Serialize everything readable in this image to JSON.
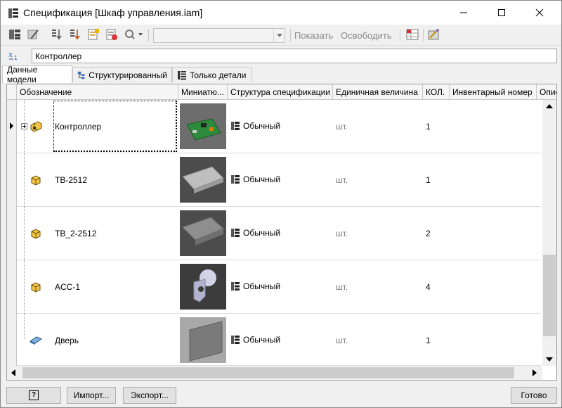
{
  "window": {
    "title": "Спецификация [Шкаф управления.iam]"
  },
  "toolbar": {
    "combo_value": "",
    "show_label": "Показать",
    "release_label": "Освободить"
  },
  "formula": {
    "value": "Контроллер"
  },
  "tabs": [
    {
      "label": "Данные модели",
      "active": true
    },
    {
      "label": "Структурированный",
      "active": false
    },
    {
      "label": "Только детали",
      "active": false
    }
  ],
  "columns": [
    "Обозначение",
    "Миниатю...",
    "Структура спецификации",
    "Единичная величина",
    "КОЛ.",
    "Инвентарный номер",
    "Опис"
  ],
  "rows": [
    {
      "name": "Контроллер",
      "structure": "Обычный",
      "unit": "шт.",
      "qty": "1",
      "icon": "assembly-icon",
      "selected": true
    },
    {
      "name": "TB-2512",
      "structure": "Обычный",
      "unit": "шт.",
      "qty": "1",
      "icon": "part-icon"
    },
    {
      "name": "TB_2-2512",
      "structure": "Обычный",
      "unit": "шт.",
      "qty": "2",
      "icon": "part-icon"
    },
    {
      "name": "ACC-1",
      "structure": "Обычный",
      "unit": "шт.",
      "qty": "4",
      "icon": "part-icon"
    },
    {
      "name": "Дверь",
      "structure": "Обычный",
      "unit": "шт.",
      "qty": "1",
      "icon": "sheet-metal-icon"
    }
  ],
  "buttons": {
    "help": "?",
    "import": "Импорт...",
    "export": "Экспорт...",
    "done": "Готово"
  }
}
